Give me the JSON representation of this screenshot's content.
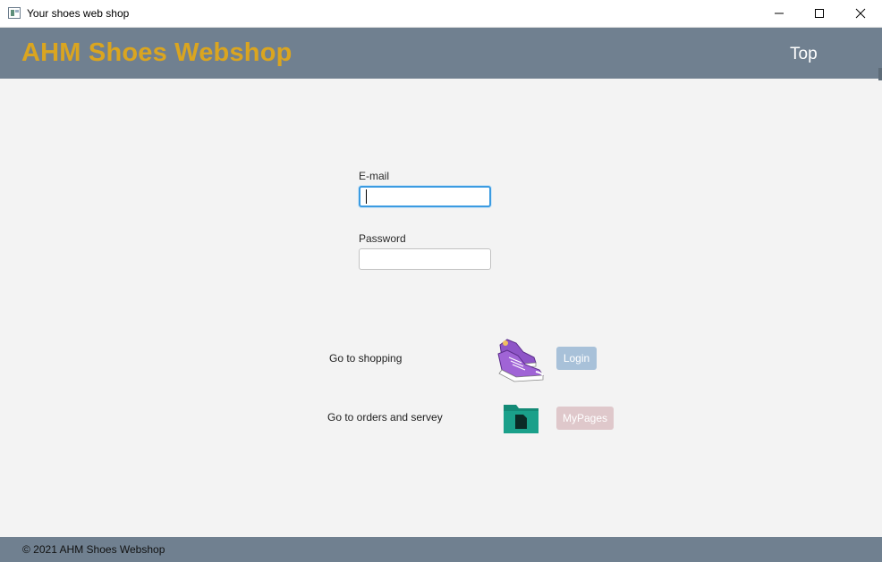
{
  "window": {
    "title": "Your shoes web shop",
    "icon": "app-window-icon",
    "controls": [
      "minimize-icon",
      "maximize-icon",
      "close-icon"
    ]
  },
  "header": {
    "title": "AHM Shoes Webshop",
    "top_link": "Top",
    "colors": {
      "background": "#708090",
      "title": "#daa520"
    }
  },
  "login_form": {
    "email": {
      "label": "E-mail",
      "value": "",
      "focused": true
    },
    "password": {
      "label": "Password",
      "value": ""
    }
  },
  "actions": [
    {
      "text": "Go to shopping",
      "icon": "sneakers-icon",
      "button": "Login",
      "button_color": "#a8c1d9"
    },
    {
      "text": "Go to orders and servey",
      "icon": "folder-icon",
      "button": "MyPages",
      "button_color": "#dfc8cb"
    }
  ],
  "footer": {
    "text": "© 2021 AHM Shoes Webshop"
  }
}
